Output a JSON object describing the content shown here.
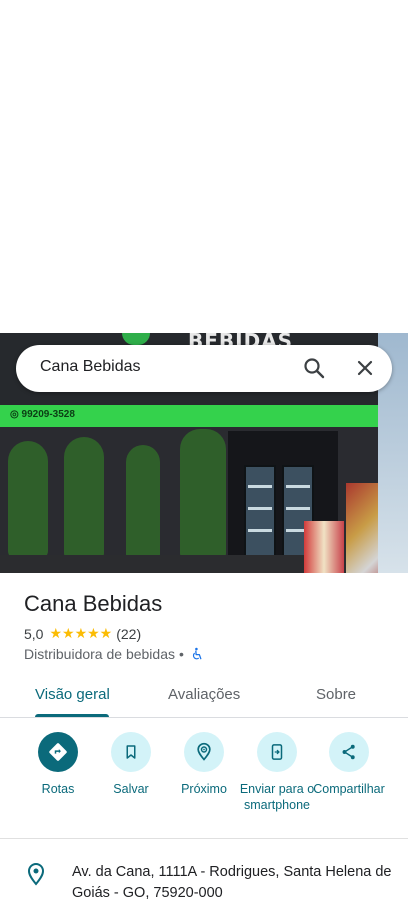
{
  "search": {
    "query": "Cana Bebidas"
  },
  "photo": {
    "sign_text": "BEBIDAS",
    "phone_text": "99209-3528"
  },
  "place": {
    "name": "Cana Bebidas",
    "rating": "5,0",
    "stars": "★★★★★",
    "review_count": "(22)",
    "category": "Distribuidora de bebidas",
    "separator": "•"
  },
  "tabs": [
    {
      "label": "Visão geral",
      "active": true
    },
    {
      "label": "Avaliações",
      "active": false
    },
    {
      "label": "Sobre",
      "active": false
    }
  ],
  "actions": [
    {
      "label": "Rotas",
      "icon": "directions-icon"
    },
    {
      "label": "Salvar",
      "icon": "bookmark-icon"
    },
    {
      "label": "Próximo",
      "icon": "nearby-icon"
    },
    {
      "label": "Enviar para o smartphone",
      "icon": "send-to-phone-icon"
    },
    {
      "label": "Compartilhar",
      "icon": "share-icon"
    }
  ],
  "address": {
    "text": "Av. da Cana, 1111A - Rodrigues, Santa Helena de Goiás - GO, 75920-000"
  },
  "colors": {
    "accent": "#0b6a7b",
    "accent_light": "#d3f3f8",
    "star": "#fbbc04",
    "accessibility": "#1a73e8"
  }
}
